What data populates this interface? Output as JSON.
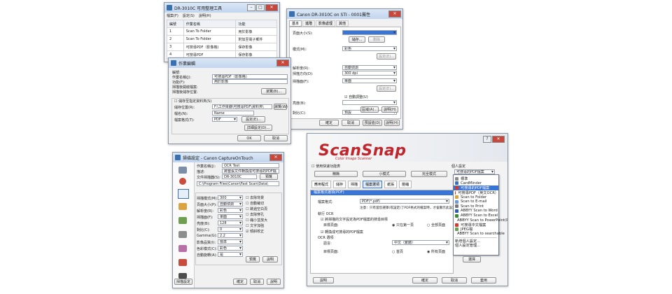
{
  "colors": {
    "accent": "#2b61a8",
    "brand_red": "#c0262d",
    "selection": "#3875d7",
    "title_bar": "#c2d5ee"
  },
  "win1": {
    "title": "DR-3010C 可用整理工具",
    "menu": [
      "檔案(F)",
      "設定(S)",
      "說明(H)"
    ],
    "columns": [
      "編號",
      "作業名稱",
      "功能"
    ],
    "rows": [
      {
        "no": "1",
        "name": "Scan To Folder",
        "func": "用於影像"
      },
      {
        "no": "2",
        "name": "Scan To Folder",
        "func": "附加至電子郵件"
      },
      {
        "no": "3",
        "name": "可搜尋PDF（影像格)",
        "func": "保存影像"
      },
      {
        "no": "4",
        "name": "可搜尋PDF",
        "func": "保存影像"
      }
    ]
  },
  "win2": {
    "title": "Canon DR-3010C on STI - 0001屬性",
    "tabs": [
      "基本",
      "進階",
      "影像處理",
      "其他"
    ],
    "labels": [
      "頁面大小(S):",
      "模式(M):",
      "解析度(R):",
      "掃描方向(D):",
      "掃描面(F):",
      "亮度(B):",
      "對比(C):"
    ],
    "values": [
      "",
      "彩色",
      "自動偵測",
      "300 dpi",
      "單面",
      "",
      "預設"
    ],
    "small_buttons": [
      "儲存...",
      "刪除",
      "設定(E)...",
      "設定(E)...",
      "區域(A)..."
    ],
    "checkbox_label": "自動調整(U)",
    "footer_buttons": [
      "確定",
      "取消",
      "預設值(D)",
      "說明(H)"
    ]
  },
  "win3": {
    "title": "作業編輯",
    "labels": [
      "編號:",
      "作業名稱(J):",
      "功能(F):",
      "掃描後開啟檔案:",
      "掃描後儲存位置:"
    ],
    "job_name": "可搜尋PDF（影像格)",
    "function_value": "用於影像",
    "browse_button": "瀏覽(B)...",
    "checkbox_label": "儲存至指定資料夾(S)",
    "field_labels": [
      "儲存位置(R):",
      "檔名(N):",
      "檔案格式(T):"
    ],
    "folder_value": "F:\\工作目錄\\可搜尋PDF\\資料夾\\",
    "filename_value": "Name",
    "format_value": "PDF",
    "buttons": [
      "瀏覽(W)",
      "設定(E)...",
      "詳細設定(D)..."
    ],
    "ok": "OK",
    "cancel": "取消"
  },
  "win4": {
    "title": "掃描設定 - Canon CaptureOnTouch",
    "top_labels": [
      "作業名稱(J):",
      "描述:"
    ],
    "job_value": "OCR Test",
    "desc_value": "將整張文件轉換成可搜尋的PDF檔",
    "scanner_label": "文件掃描器(S):",
    "scanner_value": "DR-3010C",
    "path_value": "C:\\Program Files\\Canon\\Fast Scan\\Data\\",
    "form_labels": [
      "掃描模式(M):",
      "頁面大小(P):",
      "解析度(R):",
      "掃描面(F):",
      "亮度(B):",
      "對比(C):",
      "Gamma(G):",
      "影像品質(I):",
      "色彩模式(C):",
      "自動旋轉(A):"
    ],
    "form_values": [
      "300",
      "自動偵測",
      "彩色",
      "單面",
      "128",
      "0",
      "2.2",
      "標準",
      "彩色",
      "是"
    ],
    "checks": [
      "去除背景",
      "自動裁切",
      "跳過空白頁",
      "去除穿孔",
      "縮小並放大",
      "文字加強",
      "傾斜校正"
    ],
    "buttons": [
      "預覽",
      "確定",
      "取消",
      "說明"
    ],
    "sidebar_label": "掃描設定"
  },
  "win5": {
    "brand_logo": "ScanSnap",
    "brand_sub": "Color Image Scanner",
    "quick_menu_label": "使用快速功能表",
    "top_buttons": [
      "精簡",
      "小模式",
      "完全模式"
    ],
    "profile_label": "個人設定",
    "profile_value": "可搜尋的PDF檔案",
    "tabs": [
      "應用程式",
      "儲存",
      "掃描",
      "檔案選項",
      "紙張",
      "壓縮"
    ],
    "section_header": "檔案格式選項(PDF)",
    "file_format_label": "檔案格式:",
    "file_format_value": "PDF(*.pdf)",
    "note": "注意：只有當您選擇(或設定)了PDF格式的檔案時，才會顯示此設定。",
    "ocr_group": "執行 OCR",
    "ocr_checks": [
      "將掃描的文字設定為PDF檔案的搜尋目標",
      "轉換成可搜尋的PDF檔案"
    ],
    "ocr_radio_left": "只在第一頁",
    "ocr_radio_right": "全部頁面",
    "sub_label": "目標頁面:",
    "lang_label": "語言:",
    "lang_value": "中文（繁體）",
    "pages_label": "目標頁面:",
    "radio_first": "首頁",
    "radio_all": "所有頁面",
    "dropdown_items": [
      "標準",
      "CardMinder",
      "可搜尋的PDF檔案",
      "可搜尋PDF（英文OCR）",
      "Scan to Folder",
      "Scan to E-mail",
      "Scan to Print",
      "ABBYY Scan to Word",
      "ABBYY Scan to Excel",
      "ABBYY Scan to PowerPoint(R)",
      "可搜尋中文檔案",
      "JPEG檔",
      "ABBYY Scan to searchable"
    ],
    "dropdown_selected": "可搜尋的PDF檔案",
    "dropdown_extra": [
      "新增個人設定...",
      "個人設定管理..."
    ],
    "dropdown_ok": "選擇",
    "footer_left": "説明",
    "footer_buttons": [
      "確定",
      "取消",
      "套用"
    ]
  }
}
